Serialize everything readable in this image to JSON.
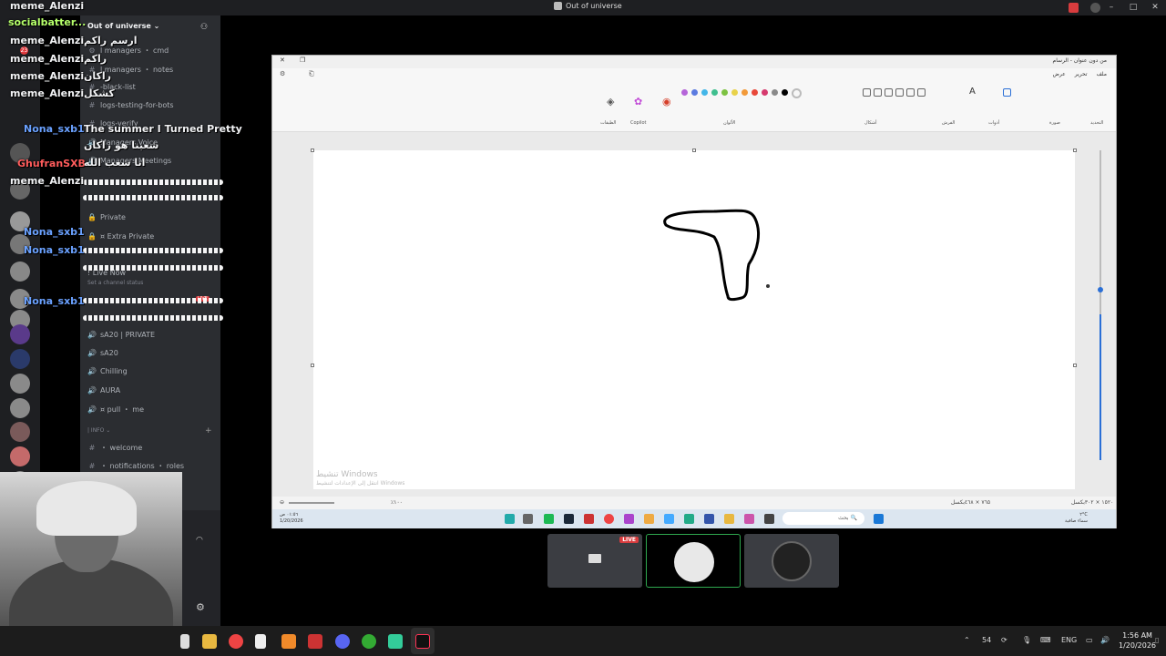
{
  "window": {
    "title": "Out of universe"
  },
  "server": {
    "name": "Out of universe",
    "badge_count": "23",
    "channels": [
      {
        "glyph": "⚙",
        "label": "ا managers ・ cmd"
      },
      {
        "glyph": "#",
        "label": "ا managers ・ notes"
      },
      {
        "glyph": "#",
        "label": "-black-list"
      },
      {
        "glyph": "#",
        "label": "logs-testing-for-bots"
      },
      {
        "glyph": "#",
        "label": "logs-verify"
      },
      {
        "glyph": "🔊",
        "label": "Managers Voice"
      },
      {
        "glyph": "🔊",
        "label": "Managers Meetings"
      }
    ],
    "private_channels": [
      {
        "glyph": "🔒",
        "label": "Private"
      },
      {
        "glyph": "🔒",
        "label": "¤ Extra Private"
      }
    ],
    "live_channel": {
      "label": "! Live Now",
      "status": "Set a channel status",
      "live_badge": "LIVE"
    },
    "voice_channels": [
      {
        "glyph": "🔊",
        "label": "sA20 | PRIVATE"
      },
      {
        "glyph": "🔊",
        "label": "sA20"
      },
      {
        "glyph": "🔊",
        "label": "Chilling"
      },
      {
        "glyph": "🔊",
        "label": "AURA"
      },
      {
        "glyph": "🔊",
        "label": "¤ pull ・ me"
      }
    ],
    "info_category": "| INFO ⌄",
    "info_channels": [
      {
        "glyph": "#",
        "label": "・ welcome"
      },
      {
        "glyph": "#",
        "label": "・ notifications ・ roles"
      }
    ]
  },
  "overlay_names": [
    {
      "text": "meme_Alenzi",
      "color": "white"
    },
    {
      "text": "socialbatter...",
      "color": "green"
    },
    {
      "text": "meme_Alenzi",
      "color": "white"
    },
    {
      "text": "meme_Alenzi",
      "color": "white"
    },
    {
      "text": "meme_Alenzi",
      "color": "white"
    },
    {
      "text": "meme_Alenzi",
      "color": "white"
    },
    {
      "text": "Nona_sxb1",
      "color": "blue"
    },
    {
      "text": "GhufranSXB",
      "color": "red"
    },
    {
      "text": "meme_Alenzi",
      "color": "white"
    },
    {
      "text": "Nona_sxb1",
      "color": "blue"
    },
    {
      "text": "Nona_sxb1",
      "color": "blue"
    },
    {
      "text": "Nona_sxb1",
      "color": "blue"
    }
  ],
  "overlay_messages": {
    "arabic_1": "ارسم راكم",
    "arabic_2": "راكم",
    "arabic_3": "راكان",
    "arabic_4": "كشكل",
    "headline": "The summer I Turned Pretty",
    "arabic_5": "شعبنا هو راكان",
    "arabic_6": "انا شعب الله"
  },
  "paint": {
    "title": "من دون عنوان - الرسام",
    "menu": [
      "ملف",
      "تحرير",
      "عرض"
    ],
    "groups": {
      "select": "التحديد",
      "image": "صورة",
      "tools": "أدوات",
      "brushes": "الفرش",
      "shapes": "أشكال",
      "colors": "الألوان",
      "copilot": "Copilot",
      "layers": "الطبقات"
    },
    "palette": [
      "#b565d9",
      "#5b7be0",
      "#43b6e8",
      "#3fbf8f",
      "#7dc242",
      "#e8d24a",
      "#f29a3a",
      "#e8483a",
      "#d63a6e",
      "#8a8a8a",
      "#000000"
    ],
    "watermark": "تنشيط Windows",
    "watermark_sub": "انتقل إلى الإعدادات لتنشيط Windows",
    "status_left": "٪١٠٠",
    "status_mid": "٧٦٥ × ٤٦٨بكسل",
    "status_right": "١٥٢٠ × ٣٠٢بكسل"
  },
  "paint_taskbar": {
    "time": "٠١:٥٦ ص",
    "date": "1/20/2026",
    "search_placeholder": "بحث",
    "weather_temp": "٢°C",
    "weather_desc": "سماء صافية"
  },
  "stream_tiles": {
    "live_badge": "LIVE"
  },
  "taskbar": {
    "tray_count": "54",
    "lang": "ENG",
    "time": "1:56 AM",
    "date": "1/20/2026"
  },
  "colors": {
    "accent_live": "#d83c3e",
    "selected_tile_border": "#2fa84f",
    "discord_sidebar": "#2b2d31"
  }
}
